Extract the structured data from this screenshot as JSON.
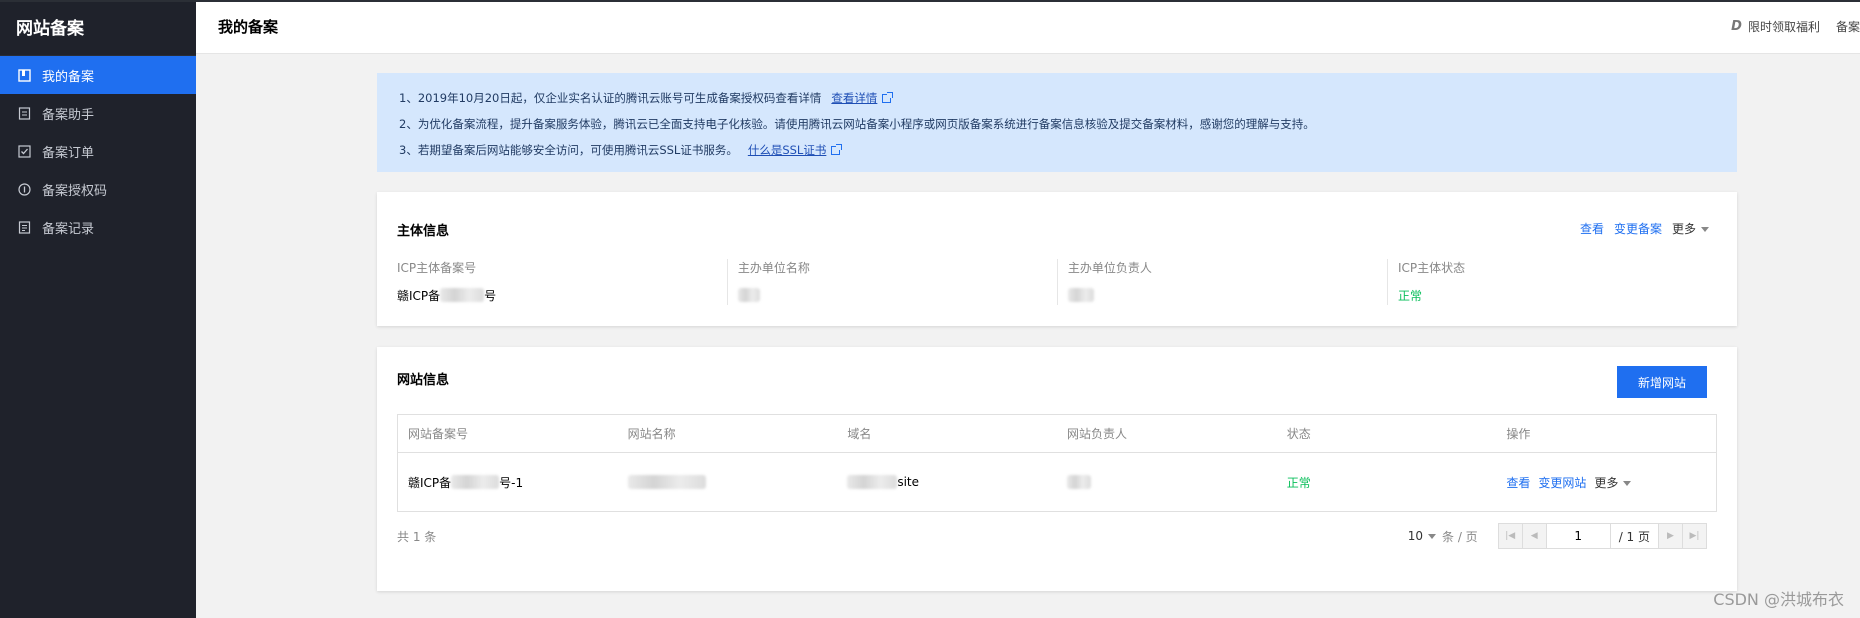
{
  "sidebar": {
    "title": "网站备案",
    "items": [
      {
        "label": "我的备案",
        "icon": "book-icon"
      },
      {
        "label": "备案助手",
        "icon": "document-icon"
      },
      {
        "label": "备案订单",
        "icon": "checkbox-icon"
      },
      {
        "label": "备案授权码",
        "icon": "number-circle-icon"
      },
      {
        "label": "备案记录",
        "icon": "record-icon"
      }
    ]
  },
  "header": {
    "title": "我的备案",
    "promo_label": "限时领取福利",
    "link2": "备案"
  },
  "notice": {
    "line1": "1、2019年10月20日起，仅企业实名认证的腾讯云账号可生成备案授权码查看详情",
    "line1_link": "查看详情",
    "line2": "2、为优化备案流程，提升备案服务体验，腾讯云已全面支持电子化核验。请使用腾讯云网站备案小程序或网页版备案系统进行备案信息核验及提交备案材料，感谢您的理解与支持。",
    "line3": "3、若期望备案后网站能够安全访问，可使用腾讯云SSL证书服务。",
    "line3_link": "什么是SSL证书"
  },
  "subject": {
    "title": "主体信息",
    "actions": {
      "view": "查看",
      "change": "变更备案",
      "more": "更多"
    },
    "fields": [
      {
        "label": "ICP主体备案号",
        "value_prefix": "赣ICP备",
        "value_suffix": "号"
      },
      {
        "label": "主办单位名称"
      },
      {
        "label": "主办单位负责人"
      },
      {
        "label": "ICP主体状态",
        "value": "正常"
      }
    ]
  },
  "website": {
    "title": "网站信息",
    "add_button": "新增网站",
    "columns": [
      "网站备案号",
      "网站名称",
      "域名",
      "网站负责人",
      "状态",
      "操作"
    ],
    "rows": [
      {
        "record_prefix": "赣ICP备",
        "record_suffix": "号-1",
        "domain_suffix": "site",
        "status": "正常",
        "view": "查看",
        "change": "变更网站",
        "more": "更多"
      }
    ],
    "pager": {
      "total": "共 1 条",
      "page_size": "10",
      "page_size_unit": "条 / 页",
      "current": "1",
      "total_pages": "/ 1 页"
    }
  },
  "watermark": "CSDN @洪城布衣"
}
